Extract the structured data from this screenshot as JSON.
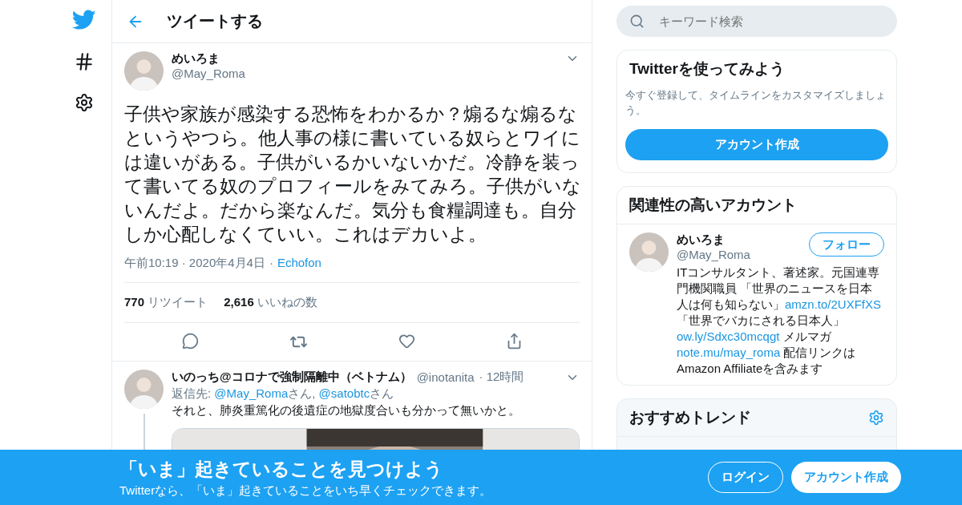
{
  "header": {
    "title": "ツイートする"
  },
  "tweet": {
    "name": "めいろま",
    "handle": "@May_Roma",
    "text": "子供や家族が感染する恐怖をわかるか？煽るな煽るなというやつら。他人事の様に書いている奴らとワイには違いがある。子供がいるかいないかだ。冷静を装って書いてる奴のプロフィールをみてみろ。子供がいないんだよ。だから楽なんだ。気分も食糧調達も。自分しか心配しなくていい。これはデカいよ。",
    "time": "午前10:19 · 2020年4月4日",
    "separator": "·",
    "source": "Echofon",
    "retweets": "770",
    "retweets_label": "リツイート",
    "likes": "2,616",
    "likes_label": "いいねの数"
  },
  "reply": {
    "name": "いのっち@コロナで強制隔離中（ベトナム）",
    "handle": "@inotanita",
    "age": "· 12時間",
    "reply_to": [
      {
        "text": "返信先: ",
        "link": false
      },
      {
        "text": "@May_Roma",
        "link": true
      },
      {
        "text": "さん, ",
        "link": false
      },
      {
        "text": "@satobtc",
        "link": true
      },
      {
        "text": "さん",
        "link": false
      }
    ],
    "text": "それと、肺炎重篤化の後遺症の地獄度合いも分かって無いかと。"
  },
  "search": {
    "placeholder": "キーワード検索"
  },
  "signup_card": {
    "title": "Twitterを使ってみよう",
    "text": "今すぐ登録して、タイムラインをカスタマイズしましょう。",
    "button": "アカウント作成"
  },
  "related": {
    "title": "関連性の高いアカウント",
    "name": "めいろま",
    "handle": "@May_Roma",
    "follow": "フォロー",
    "bio": [
      {
        "text": "ITコンサルタント、著述家。元国連専門機関職員 「世界のニュースを日本人は何も知らない」",
        "link": false
      },
      {
        "text": "amzn.to/2UXFfXS",
        "link": true
      },
      {
        "text": "「世界でバカにされる日本人」 ",
        "link": false
      },
      {
        "text": "ow.ly/Sdxc30mcqgt",
        "link": true
      },
      {
        "text": " メルマガ ",
        "link": false
      },
      {
        "text": "note.mu/may_roma",
        "link": true
      },
      {
        "text": " 配信リンクは Amazon Affiliateを含みます",
        "link": false
      }
    ]
  },
  "trends": {
    "title": "おすすめトレンド"
  },
  "banner": {
    "title": "「いま」起きていることを見つけよう",
    "subtitle": "Twitterなら、「いま」起きていることをいち早くチェックできます。",
    "login": "ログイン",
    "signup": "アカウント作成"
  }
}
